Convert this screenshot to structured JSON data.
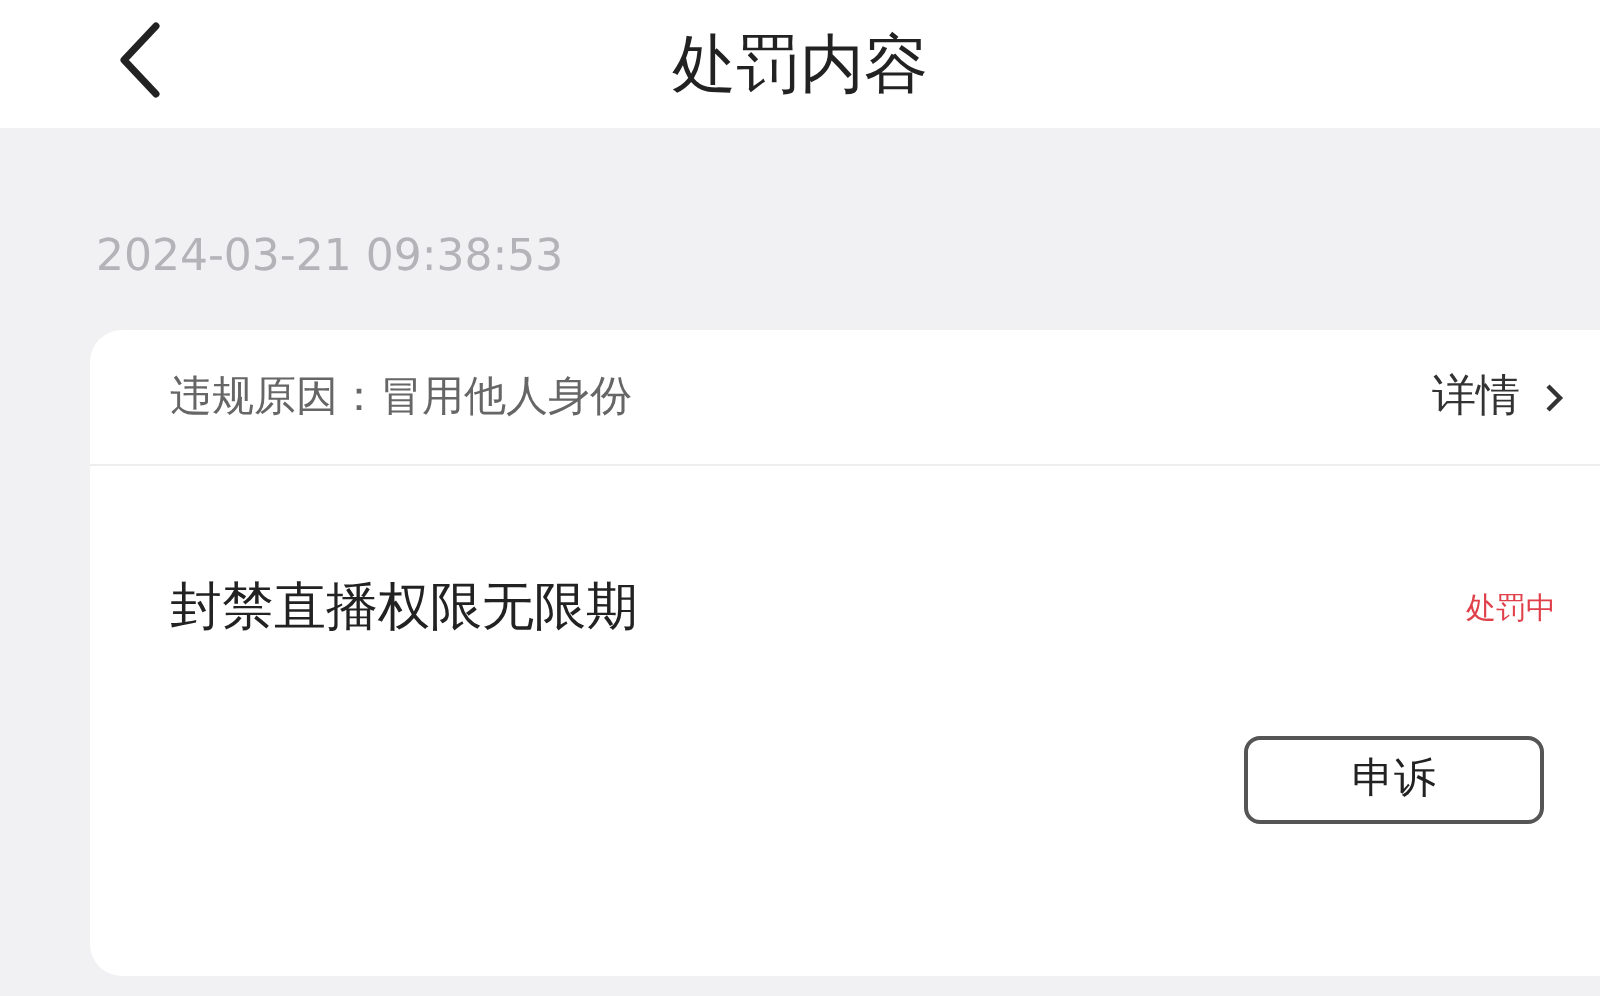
{
  "header": {
    "title": "处罚内容"
  },
  "record": {
    "time": "2024-03-21 09:38:53",
    "reason": "违规原因：冒用他人身份",
    "detail_link": "详情",
    "penalty": "封禁直播权限无限期",
    "status": "处罚中",
    "action": "申诉"
  }
}
